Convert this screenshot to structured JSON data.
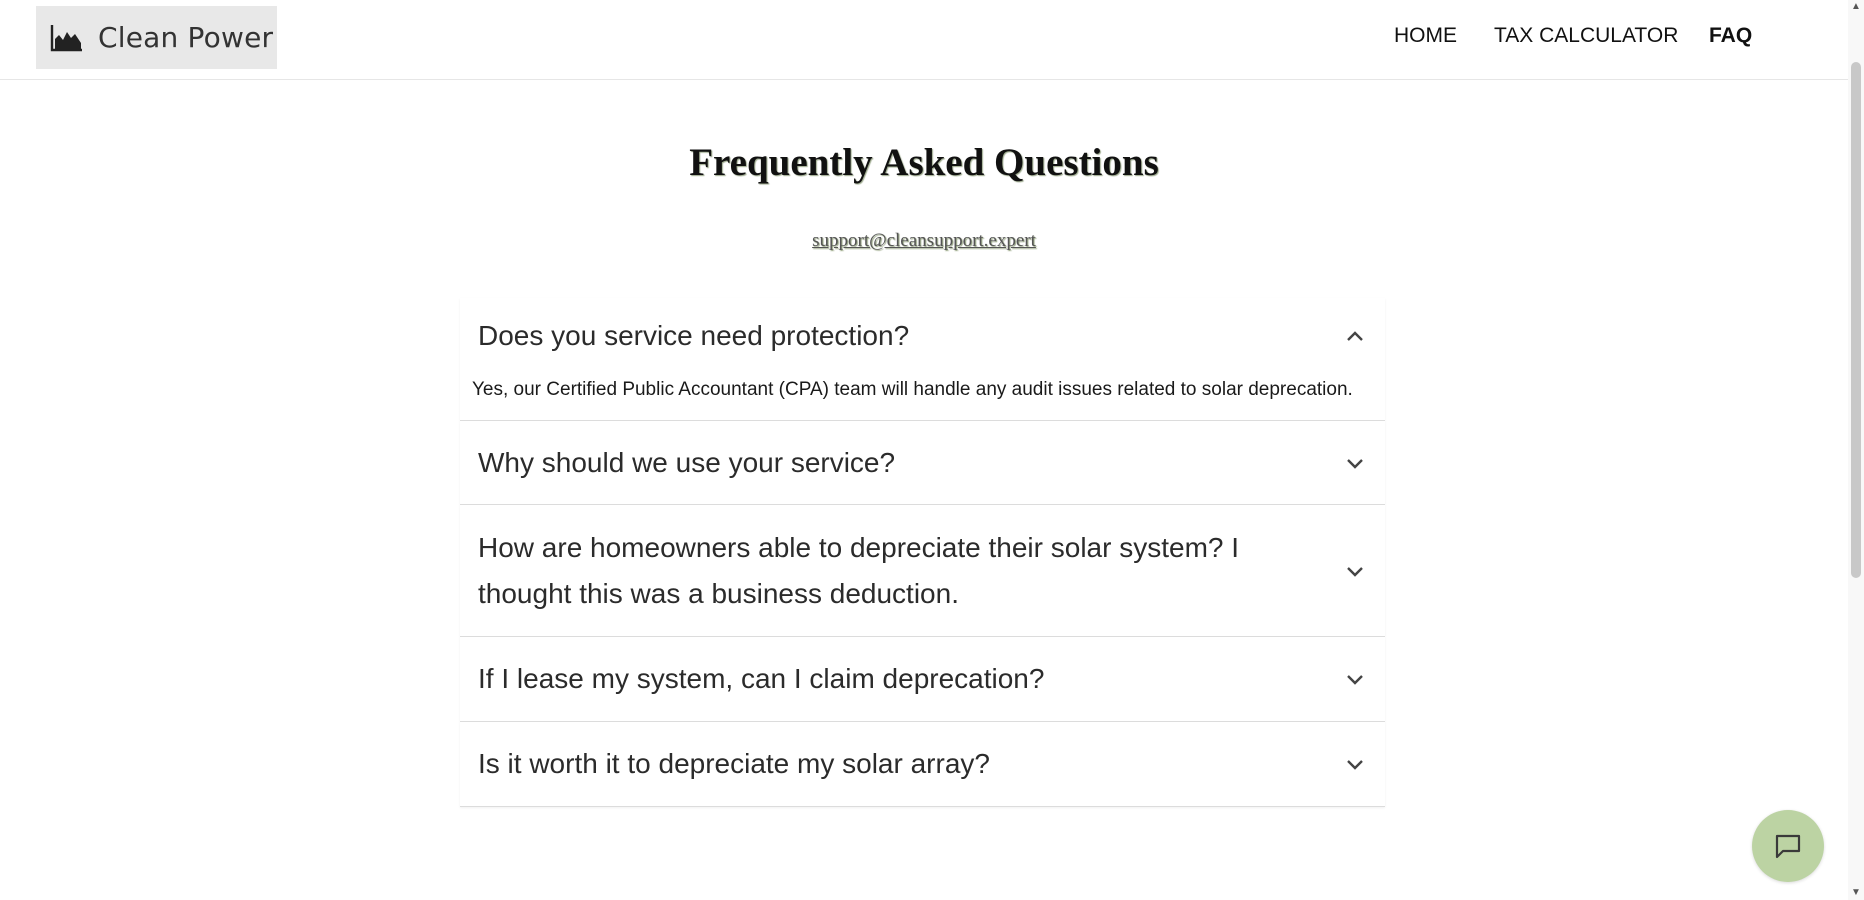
{
  "header": {
    "brand": "Clean Power",
    "brand_icon": "area-chart-icon",
    "nav": [
      {
        "label": "HOME"
      },
      {
        "label": "TAX CALCULATOR"
      },
      {
        "label": "FAQ",
        "active": true
      }
    ]
  },
  "page": {
    "title": "Frequently Asked Questions",
    "support_email": "support@cleansupport.expert"
  },
  "faq": [
    {
      "question": "Does you service need protection?",
      "answer": "Yes, our Certified Public Accountant (CPA) team will handle any audit issues related to solar deprecation.",
      "expanded": true
    },
    {
      "question": "Why should we use your service?",
      "expanded": false
    },
    {
      "question": "How are homeowners able to depreciate their solar system? I thought this was a business deduction.",
      "expanded": false
    },
    {
      "question": "If I lease my system, can I claim deprecation?",
      "expanded": false
    },
    {
      "question": "Is it worth it to depreciate my solar array?",
      "expanded": false
    }
  ],
  "chat": {
    "icon": "chat-bubble-icon"
  },
  "colors": {
    "chat_bg": "#bcd3a3",
    "brand_bg": "#e8e8e8",
    "title_shadow": "#9aa78a"
  }
}
